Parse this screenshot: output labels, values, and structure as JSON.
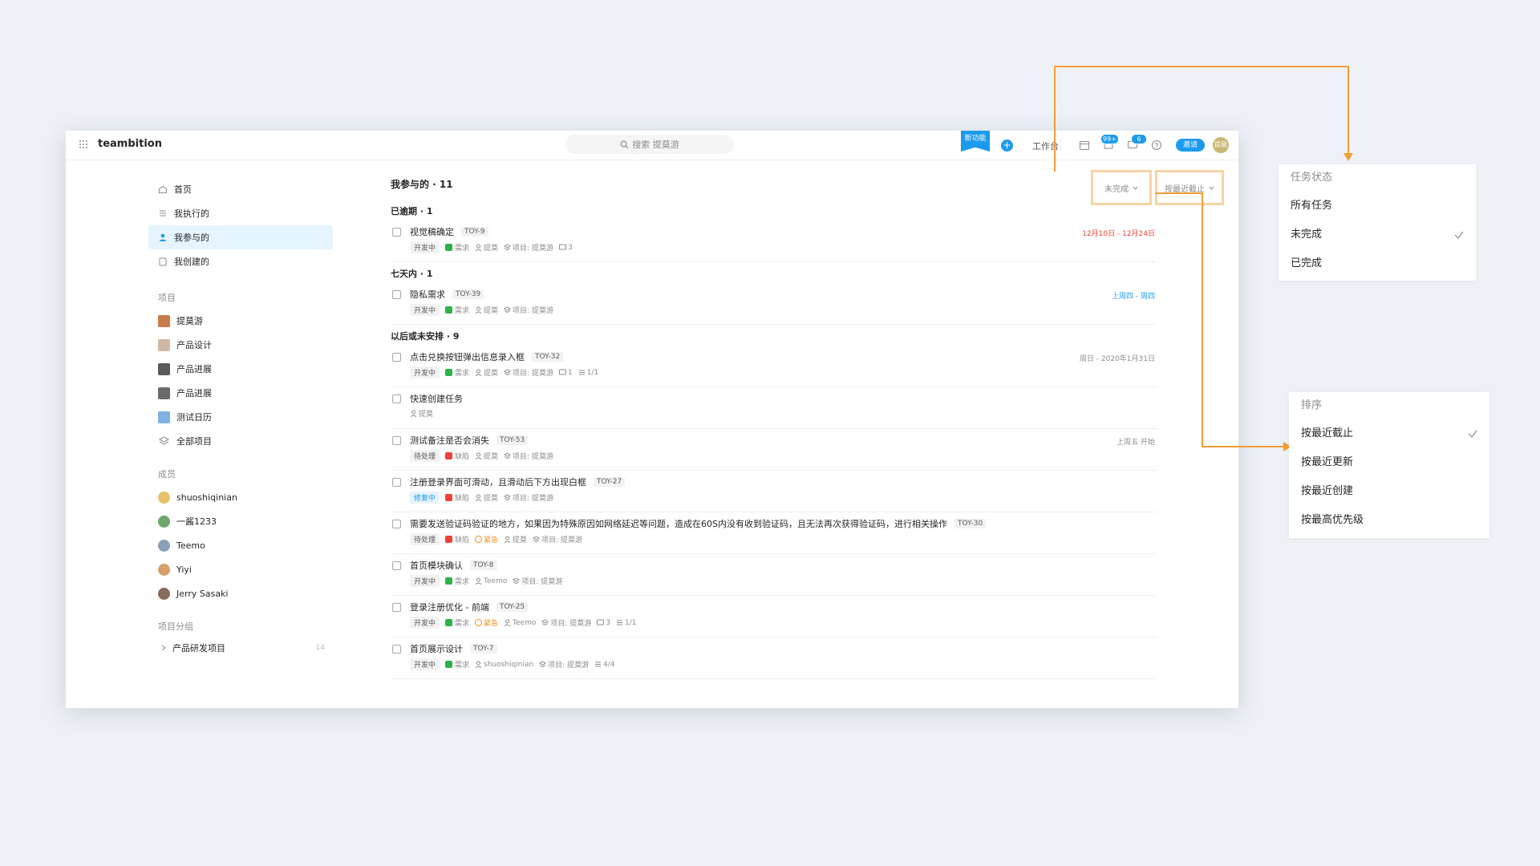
{
  "brand": "teambition",
  "search_placeholder": "搜索 提莫游",
  "header": {
    "new_feature": "新功能",
    "plus": "+",
    "workbench": "工作台",
    "inbox_badge": "99+",
    "chat_badge": "6",
    "invite": "邀请",
    "avatar_text": "提莫"
  },
  "nav": [
    "首页",
    "我执行的",
    "我参与的",
    "我创建的"
  ],
  "projects_title": "项目",
  "projects": [
    {
      "name": "提莫游",
      "color": "#c97b4a"
    },
    {
      "name": "产品设计",
      "color": "#d0b8a6"
    },
    {
      "name": "产品进展",
      "color": "#5a5a5a"
    },
    {
      "name": "产品进展",
      "color": "#6b6b6b"
    },
    {
      "name": "测试日历",
      "color": "#7fb3e6"
    },
    {
      "name": "全部项目",
      "color": ""
    }
  ],
  "members_title": "成员",
  "members": [
    {
      "name": "shuoshiqinian",
      "color": "#e8c26a"
    },
    {
      "name": "一酱1233",
      "color": "#6fa86a"
    },
    {
      "name": "Teemo",
      "color": "#8aa0b8"
    },
    {
      "name": "Yiyi",
      "color": "#d8a06a"
    },
    {
      "name": "Jerry Sasaki",
      "color": "#8a6a5a"
    }
  ],
  "groups_title": "项目分组",
  "group": {
    "name": "产品研发项目",
    "count": "14"
  },
  "main": {
    "title": "我参与的 · 11",
    "filter": "未完成",
    "sort": "按最近截止"
  },
  "sections": [
    {
      "title": "已逾期 · 1",
      "tasks": [
        {
          "title": "视觉稿确定",
          "id": "TOY-9",
          "status": "开发中",
          "type": "需求",
          "priority": "",
          "assignee": "提莫",
          "project": "项目: 提莫游",
          "comments": "3",
          "subtasks": "",
          "date": "12月10日 - 12月24日"
        }
      ]
    },
    {
      "title": "七天内 · 1",
      "tasks": [
        {
          "title": "隐私需求",
          "id": "TOY-39",
          "status": "开发中",
          "type": "需求",
          "priority": "",
          "assignee": "提莫",
          "project": "项目: 提莫游",
          "comments": "",
          "subtasks": "",
          "date": "上周四 - 周四"
        }
      ]
    },
    {
      "title": "以后或未安排 · 9",
      "tasks": [
        {
          "title": "点击兑换按钮弹出信息录入框",
          "id": "TOY-32",
          "status": "开发中",
          "type": "需求",
          "priority": "",
          "assignee": "提莫",
          "project": "项目: 提莫游",
          "comments": "1",
          "subtasks": "1/1",
          "date": "周日 - 2020年1月31日"
        },
        {
          "title": "快速创建任务",
          "id": "",
          "status": "",
          "type": "",
          "priority": "",
          "assignee": "提莫",
          "project": "",
          "comments": "",
          "subtasks": "",
          "date": ""
        },
        {
          "title": "测试备注是否会消失",
          "id": "TOY-53",
          "status": "待处理",
          "type": "缺陷",
          "priority": "",
          "assignee": "提莫",
          "project": "项目: 提莫游",
          "comments": "",
          "subtasks": "",
          "date": "上周五 开始"
        },
        {
          "title": "注册登录界面可滑动，且滑动后下方出现白框",
          "id": "TOY-27",
          "status": "修复中",
          "type": "缺陷",
          "priority": "",
          "assignee": "提莫",
          "project": "项目: 提莫游",
          "comments": "",
          "subtasks": "",
          "date": ""
        },
        {
          "title": "需要发送验证码验证的地方，如果因为特殊原因如网络延迟等问题，造成在60S内没有收到验证码，且无法再次获得验证码，进行相关操作",
          "id": "TOY-30",
          "status": "待处理",
          "type": "缺陷",
          "priority": "紧急",
          "assignee": "提莫",
          "project": "项目: 提莫游",
          "comments": "",
          "subtasks": "",
          "date": ""
        },
        {
          "title": "首页模块确认",
          "id": "TOY-8",
          "status": "开发中",
          "type": "需求",
          "priority": "",
          "assignee": "Teemo",
          "project": "项目: 提莫游",
          "comments": "",
          "subtasks": "",
          "date": ""
        },
        {
          "title": "登录注册优化 - 前端",
          "id": "TOY-25",
          "status": "开发中",
          "type": "需求",
          "priority": "紧急",
          "assignee": "Teemo",
          "project": "项目: 提莫游",
          "comments": "3",
          "subtasks": "1/1",
          "date": ""
        },
        {
          "title": "首页展示设计",
          "id": "TOY-7",
          "status": "开发中",
          "type": "需求",
          "priority": "",
          "assignee": "shuoshiqinian",
          "project": "项目: 提莫游",
          "comments": "",
          "subtasks": "4/4",
          "date": ""
        }
      ]
    }
  ],
  "status_panel": {
    "title": "任务状态",
    "options": [
      "所有任务",
      "未完成",
      "已完成"
    ],
    "selected": 1
  },
  "sort_panel": {
    "title": "排序",
    "options": [
      "按最近截止",
      "按最近更新",
      "按最近创建",
      "按最高优先级"
    ],
    "selected": 0
  },
  "colors": {
    "accent": "#1b9aee",
    "annotation": "#f29d38",
    "overdue": "#f04134",
    "requirement": "#2db24a",
    "bug": "#f04134",
    "urgent": "#fa8c16"
  }
}
